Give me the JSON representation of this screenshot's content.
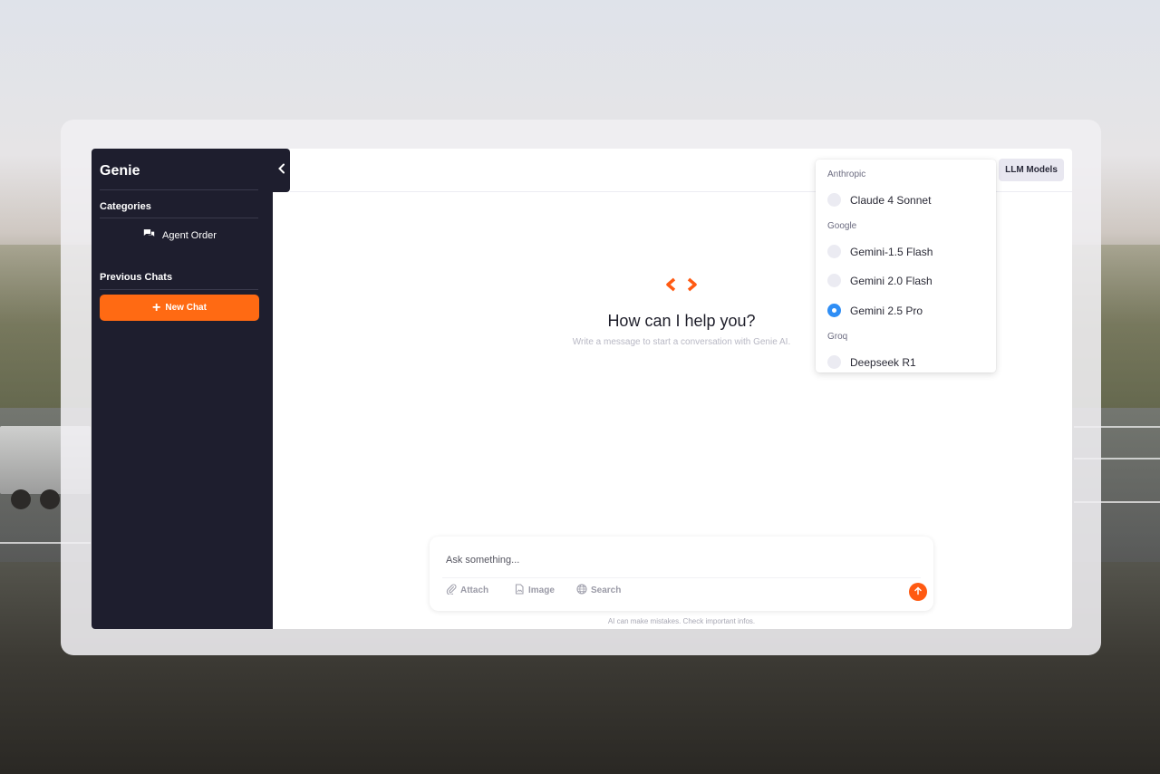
{
  "sidebar": {
    "title": "Genie",
    "categories_label": "Categories",
    "categories": [
      {
        "label": "Agent Order",
        "icon": "chat-bubbles-icon"
      }
    ],
    "previous_chats_label": "Previous Chats",
    "new_chat_label": "New Chat",
    "collapse_icon": "chevron-left-icon"
  },
  "header": {
    "llm_button_label": "LLM Models"
  },
  "model_menu": {
    "groups": [
      {
        "name": "Anthropic",
        "items": [
          {
            "label": "Claude 4 Sonnet",
            "selected": false
          }
        ]
      },
      {
        "name": "Google",
        "items": [
          {
            "label": "Gemini-1.5 Flash",
            "selected": false
          },
          {
            "label": "Gemini 2.0 Flash",
            "selected": false
          },
          {
            "label": "Gemini 2.5 Pro",
            "selected": true
          }
        ]
      },
      {
        "name": "Groq",
        "items": [
          {
            "label": "Deepseek R1",
            "selected": false
          }
        ]
      }
    ]
  },
  "main": {
    "logo_icon": "code-brackets-icon",
    "title": "How can I help you?",
    "subtitle": "Write a message to start a conversation with Genie AI."
  },
  "composer": {
    "placeholder": "Ask something...",
    "attach_label": "Attach",
    "image_label": "Image",
    "search_label": "Search",
    "send_icon": "arrow-up-icon",
    "disclaimer": "AI can make mistakes. Check important infos."
  },
  "colors": {
    "accent": "#ff6a13",
    "sidebar_bg": "#1e1e2e",
    "radio_selected": "#2f8ef5"
  }
}
